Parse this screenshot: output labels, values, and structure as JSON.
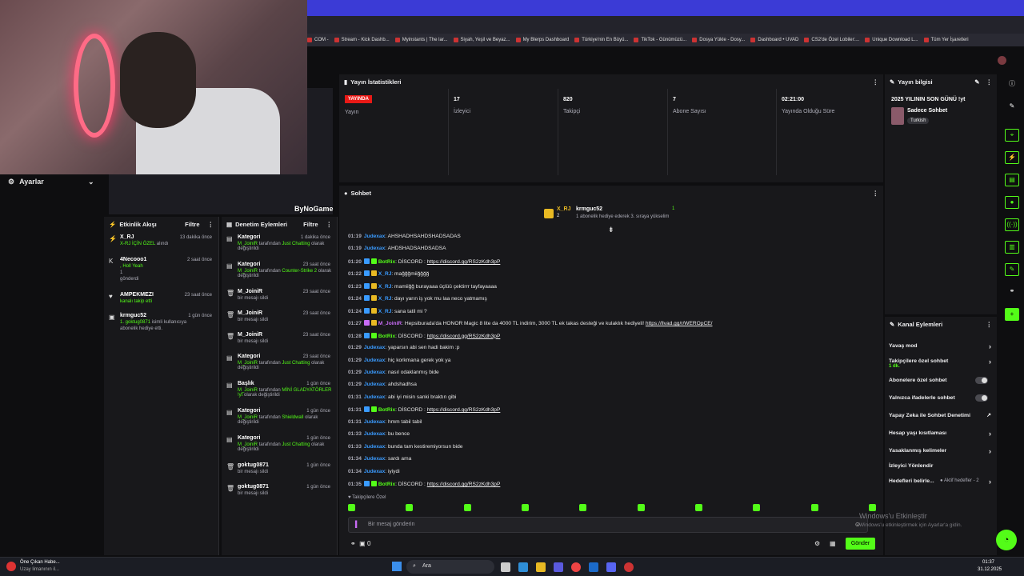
{
  "webcam": {
    "overlay_text": "ByNoGame"
  },
  "bookmarks": [
    "COM -",
    "Stream - Kick Dashb...",
    "Myinstants | The lar...",
    "Siyah, Yeşil ve Beyaz...",
    "My Blerps Dashboard",
    "Türkiye'nin En Büyü...",
    "TikTok - Günümüzü...",
    "Dosya Yükle - Dosy...",
    "Dashboard • UVAD",
    "CS2'de Özel Lobiler:...",
    "Unique Download L...",
    "Tüm Yer İşaretleri"
  ],
  "left": {
    "settings_label": "Ayarlar",
    "activity": {
      "title": "Etkinlik Akışı",
      "filter": "Filtre",
      "items": [
        {
          "name": "X_RJ",
          "time": "13 dakika önce",
          "line1": "X-RJ İÇİN ÖZEL",
          "line1b": "alındı",
          "line2": ""
        },
        {
          "name": "4Necooo1",
          "time": "2 saat önce",
          "line1": ", Holl Yeah",
          "line1b": "",
          "line2": "1",
          "line3": "gönderdi"
        },
        {
          "name": "AMPEKMEZI",
          "time": "23 saat önce",
          "line1": "kanalı takip etti",
          "line1b": "",
          "line2": ""
        },
        {
          "name": "krmguc52",
          "time": "1 gün önce",
          "line1": "1. goktug0871",
          "line1b": "isimli kullanıcıya",
          "line2": "abonelik hediye etti."
        }
      ]
    },
    "moderation": {
      "title": "Denetim Eylemleri",
      "filter": "Filtre",
      "items": [
        {
          "name": "Kategori",
          "time": "1 dakika önce",
          "actor": "M_JoiniR",
          "mid": "tarafından",
          "target": "Just Chatting",
          "rest": "olarak değiştirildi"
        },
        {
          "name": "Kategori",
          "time": "23 saat önce",
          "actor": "M_JoiniR",
          "mid": "tarafından",
          "target": "Counter-Strike 2",
          "rest": "olarak değiştirildi"
        },
        {
          "name": "M_JoiniR",
          "time": "23 saat önce",
          "actor": "",
          "mid": "",
          "target": "",
          "rest": "bir mesajı sildi"
        },
        {
          "name": "M_JoiniR",
          "time": "23 saat önce",
          "actor": "",
          "mid": "",
          "target": "",
          "rest": "bir mesajı sildi"
        },
        {
          "name": "M_JoiniR",
          "time": "23 saat önce",
          "actor": "",
          "mid": "",
          "target": "",
          "rest": "bir mesajı sildi"
        },
        {
          "name": "Kategori",
          "time": "23 saat önce",
          "actor": "M_JoiniR",
          "mid": "tarafından",
          "target": "Just Chatting",
          "rest": "olarak değiştirildi"
        },
        {
          "name": "Başlık",
          "time": "1 gün önce",
          "actor": "M_JoiniR",
          "mid": "tarafından",
          "target": "MİNİ GLADYATÖRLER !yt",
          "rest": "olarak değiştirildi"
        },
        {
          "name": "Kategori",
          "time": "1 gün önce",
          "actor": "M_JoiniR",
          "mid": "tarafından",
          "target": "Shieldwall",
          "rest": "olarak değiştirildi"
        },
        {
          "name": "Kategori",
          "time": "1 gün önce",
          "actor": "M_JoiniR",
          "mid": "tarafından",
          "target": "Just Chatting",
          "rest": "olarak değiştirildi"
        },
        {
          "name": "goktug0871",
          "time": "1 gün önce",
          "actor": "",
          "mid": "",
          "target": "",
          "rest": "bir mesajı sildi"
        },
        {
          "name": "goktug0871",
          "time": "1 gün önce",
          "actor": "",
          "mid": "",
          "target": "",
          "rest": "bir mesajı sildi"
        }
      ]
    }
  },
  "stats": {
    "title": "Yayın İstatistikleri",
    "live_badge": "YAYINDA",
    "live_label": "Yayın",
    "viewers": "17",
    "viewers_label": "İzleyici",
    "followers": "820",
    "followers_label": "Takipçi",
    "subs": "7",
    "subs_label": "Abone Sayısı",
    "uptime": "02:21:00",
    "uptime_label": "Yayında Olduğu Süre"
  },
  "chat": {
    "title": "Sohbet",
    "pin_user1": "X_RJ",
    "pin_count1": "2",
    "pin_user2": "krmguc52",
    "pin_count2": "1",
    "pin_text": "1 abonelik hediye ederek 3. sıraya yükselim",
    "messages": [
      {
        "t": "01:19",
        "u": "Judexax",
        "uc": "u",
        "txt": ": AHSHADHSAHDSHADSADAS"
      },
      {
        "t": "01:19",
        "u": "Judexax",
        "uc": "u",
        "txt": ": AHDSHADSAHDSADSA"
      },
      {
        "t": "01:20",
        "u": "BotRix",
        "uc": "ug",
        "txt": ": DİSCORD : ",
        "link": "https://discord.gg/RS2zKdh3pP"
      },
      {
        "t": "01:22",
        "u": "X_RJ",
        "uc": "u",
        "txt": ": mağğğmiiğğğğ"
      },
      {
        "t": "01:23",
        "u": "X_RJ",
        "uc": "u",
        "txt": ": mamiiğğ burayaaa üçlüü çektirrr tayfayaaaa"
      },
      {
        "t": "01:24",
        "u": "X_RJ",
        "uc": "u",
        "txt": ": dayı yarın iş yok mu laa neco yatmamış"
      },
      {
        "t": "01:24",
        "u": "X_RJ",
        "uc": "u",
        "txt": ": sana tatil mi ?"
      },
      {
        "t": "01:27",
        "u": "M_JoiniR",
        "uc": "up",
        "txt": ": Hepsiburada'da HONOR Magic 8 lite da 4000 TL indirim, 3000 TL ek takas desteği ve kulaklık hediyeli! ",
        "link": "https://llvad.gg/r/WEROpCE/"
      },
      {
        "t": "01:28",
        "u": "BotRix",
        "uc": "ug",
        "txt": ": DİSCORD : ",
        "link": "https://discord.gg/RS2zKdh3pP"
      },
      {
        "t": "01:29",
        "u": "Judexax",
        "uc": "u",
        "txt": ": yaparsın abi sen hadi bakim :p"
      },
      {
        "t": "01:29",
        "u": "Judexax",
        "uc": "u",
        "txt": ": hiç korkmana gerek yok ya"
      },
      {
        "t": "01:29",
        "u": "Judexax",
        "uc": "u",
        "txt": ": nasıl odaklanmış bide"
      },
      {
        "t": "01:29",
        "u": "Judexax",
        "uc": "u",
        "txt": ": ahdshadhsa"
      },
      {
        "t": "01:31",
        "u": "Judexax",
        "uc": "u",
        "txt": ": abi iyi misin sanki braktın gibi"
      },
      {
        "t": "01:31",
        "u": "BotRix",
        "uc": "ug",
        "txt": ": DİSCORD : ",
        "link": "https://discord.gg/RS2zKdh3pP"
      },
      {
        "t": "01:31",
        "u": "Judexax",
        "uc": "u",
        "txt": ": hmm tabil tabil"
      },
      {
        "t": "01:33",
        "u": "Judexax",
        "uc": "u",
        "txt": ": bu bence"
      },
      {
        "t": "01:33",
        "u": "Judexax",
        "uc": "u",
        "txt": ": bunda tam kestiremiyorsun bide"
      },
      {
        "t": "01:34",
        "u": "Judexax",
        "uc": "u",
        "txt": ": sardı ama"
      },
      {
        "t": "01:34",
        "u": "Judexax",
        "uc": "u",
        "txt": ": iyiydi"
      },
      {
        "t": "01:35",
        "u": "BotRix",
        "uc": "ug",
        "txt": ": DİSCORD : ",
        "link": "https://discord.gg/RS2zKdh3pP"
      }
    ],
    "followers_only_label": "Takipçilere Özel",
    "input_placeholder": "Bir mesaj gönderin",
    "points": "0",
    "send_label": "Gönder"
  },
  "info": {
    "title": "Yayın bilgisi",
    "stream_title": "2025 YILININ SON GÜNÜ !yt",
    "category": "Sadece Sohbet",
    "tag": "Turkish"
  },
  "channel_actions": {
    "title": "Kanal Eylemleri",
    "items": [
      {
        "label": "Yavaş mod",
        "type": "chev",
        "sub": ""
      },
      {
        "label": "Takipçilere özel sohbet",
        "type": "chev",
        "sub": "1 dk."
      },
      {
        "label": "Abonelere özel sohbet",
        "type": "toggle",
        "sub": ""
      },
      {
        "label": "Yalnızca ifadelerle sohbet",
        "type": "toggle",
        "sub": ""
      },
      {
        "label": "Yapay Zeka ile Sohbet Denetimi",
        "type": "ext",
        "sub": ""
      },
      {
        "label": "Hesap yaşı kısıtlaması",
        "type": "chev",
        "sub": ""
      },
      {
        "label": "Yasaklanmış kelimeler",
        "type": "chev",
        "sub": ""
      },
      {
        "label": "İzleyici Yönlendir",
        "type": "none",
        "sub": ""
      },
      {
        "label": "Hedefleri belirle...",
        "type": "chev",
        "sub": "",
        "extra": "● Aktif hedefler - 2"
      }
    ]
  },
  "windows": {
    "activate1": "Windows'u Etkinleştir",
    "activate2": "Windows'u etkinleştirmek için Ayarlar'a gidin.",
    "news1": "Öne Çıkan Habe...",
    "news2": "Uzay limanının il...",
    "search": "Ara",
    "time": "01:37",
    "date": "31.12.2025"
  },
  "colors": {
    "accent": "#53fc18",
    "live": "#e91916",
    "bg": "#0e0e10",
    "panel": "#18181b",
    "username": "#3a9bff"
  }
}
